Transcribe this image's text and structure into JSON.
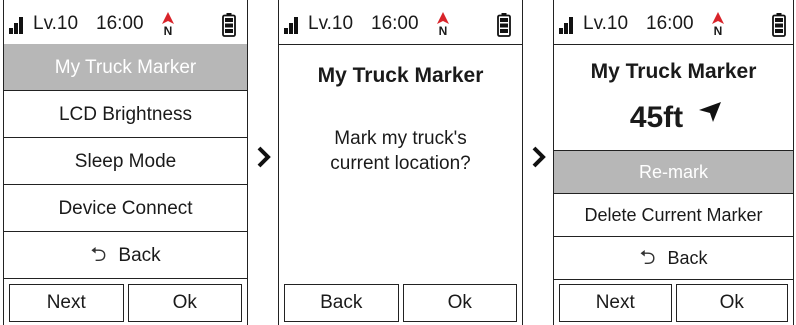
{
  "status": {
    "level": "Lv.10",
    "time": "16:00",
    "compass_letter": "N"
  },
  "screen1": {
    "menu": [
      "My Truck Marker",
      "LCD Brightness",
      "Sleep Mode",
      "Device Connect"
    ],
    "back_label": "Back",
    "softkeys": {
      "left": "Next",
      "right": "Ok"
    }
  },
  "screen2": {
    "title": "My Truck Marker",
    "message_line1": "Mark my truck's",
    "message_line2": "current location?",
    "softkeys": {
      "left": "Back",
      "right": "Ok"
    }
  },
  "screen3": {
    "title": "My Truck Marker",
    "distance": "45ft",
    "menu": [
      "Re-mark",
      "Delete Current Marker"
    ],
    "back_label": "Back",
    "softkeys": {
      "left": "Next",
      "right": "Ok"
    }
  },
  "colors": {
    "selected_bg": "#b7b7b7",
    "compass_red": "#d8232a"
  },
  "icons": [
    "signal-icon",
    "compass-north-icon",
    "battery-icon",
    "back-arrow-icon",
    "direction-arrow-icon",
    "chevron-right-icon"
  ]
}
